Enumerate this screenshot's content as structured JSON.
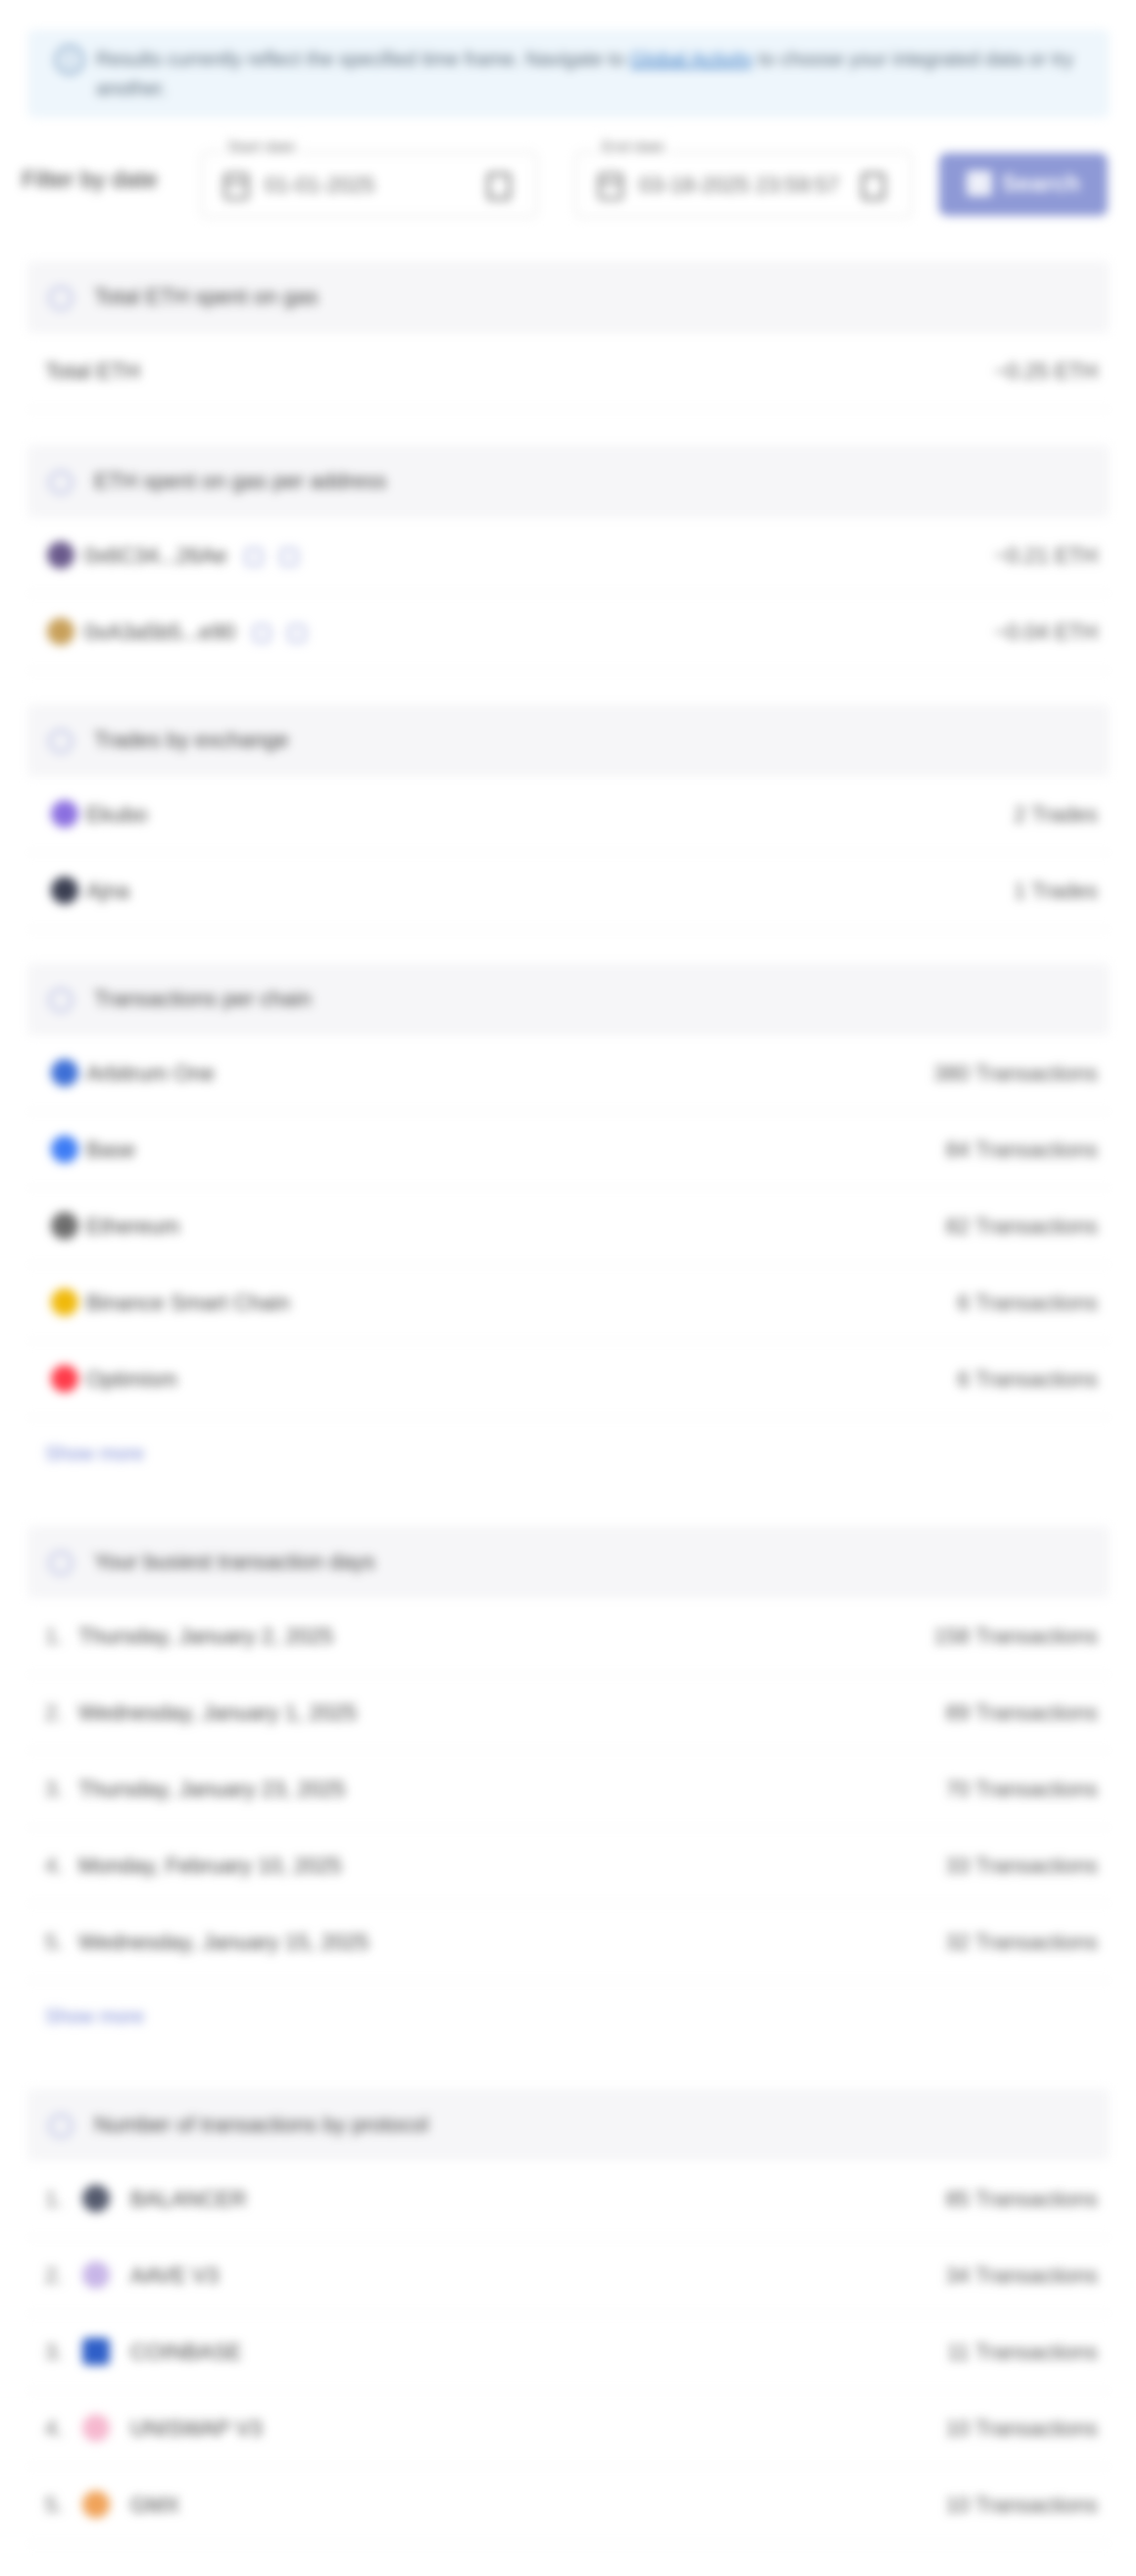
{
  "alert": {
    "text_before": "Results currently reflect the specified time frame. Navigate to",
    "link": "Global Activity",
    "text_after": "to choose your integrated data or try another."
  },
  "filter": {
    "label": "Filter by date",
    "start": {
      "legend": "Start date",
      "value": "01-01-2025"
    },
    "end": {
      "legend": "End date",
      "value": "03-18-2025 23:59:57"
    },
    "search_label": "Search"
  },
  "gas_total": {
    "title": "Total ETH spent on gas",
    "rows": [
      {
        "label": "Total ETH",
        "value": "~0.25 ETH"
      }
    ]
  },
  "gas_per_address": {
    "title": "ETH spent on gas per address",
    "rows": [
      {
        "label": "0x6C34...26Ae",
        "value": "~0.21 ETH"
      },
      {
        "label": "0xA3a5b5...e90",
        "value": "~0.04 ETH"
      }
    ]
  },
  "trades": {
    "title": "Trades by exchange",
    "rows": [
      {
        "label": "Ekubo",
        "value": "2 Trades"
      },
      {
        "label": "Ajna",
        "value": "1 Trades"
      }
    ]
  },
  "tx_chain": {
    "title": "Transactions per chain",
    "rows": [
      {
        "label": "Arbitrum One",
        "value": "380 Transactions"
      },
      {
        "label": "Base",
        "value": "84 Transactions"
      },
      {
        "label": "Ethereum",
        "value": "82 Transactions"
      },
      {
        "label": "Binance Smart Chain",
        "value": "6 Transactions"
      },
      {
        "label": "Optimism",
        "value": "6 Transactions"
      }
    ],
    "show_more": "Show more"
  },
  "busiest_days": {
    "title": "Your busiest transaction days",
    "rows": [
      {
        "rank": "1.",
        "label": "Thursday, January 2, 2025",
        "value": "158 Transactions"
      },
      {
        "rank": "2.",
        "label": "Wednesday, January 1, 2025",
        "value": "89 Transactions"
      },
      {
        "rank": "3.",
        "label": "Thursday, January 23, 2025",
        "value": "70 Transactions"
      },
      {
        "rank": "4.",
        "label": "Monday, February 10, 2025",
        "value": "33 Transactions"
      },
      {
        "rank": "5.",
        "label": "Wednesday, January 15, 2025",
        "value": "32 Transactions"
      }
    ],
    "show_more": "Show more"
  },
  "protocols": {
    "title": "Number of transactions by protocol",
    "rows": [
      {
        "rank": "1.",
        "label": "BALANCER",
        "value": "85 Transactions"
      },
      {
        "rank": "2.",
        "label": "AAVE V3",
        "value": "34 Transactions"
      },
      {
        "rank": "3.",
        "label": "COINBASE",
        "value": "11 Transactions"
      },
      {
        "rank": "4.",
        "label": "UNISWAP V3",
        "value": "10 Transactions"
      },
      {
        "rank": "5.",
        "label": "GMX",
        "value": "10 Transactions"
      }
    ]
  },
  "colors": {
    "accent": "#8e99d6",
    "ekubo": "#8b6fe0",
    "ajna": "#3b3f52",
    "arbitrum": "#3d6fd6",
    "base": "#3d7cf5",
    "ethereum": "#6e6e6e",
    "bsc": "#f0b90b",
    "optimism": "#ff3b4a"
  }
}
